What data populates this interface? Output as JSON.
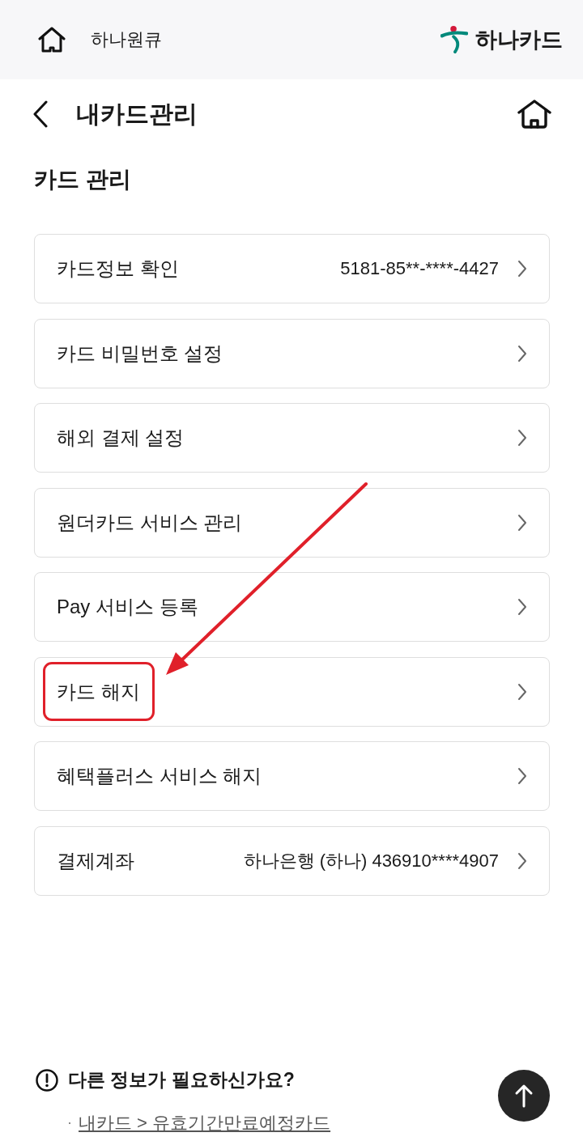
{
  "top_bar": {
    "title": "하나원큐",
    "brand": "하나카드"
  },
  "header": {
    "title": "내카드관리"
  },
  "section": {
    "title": "카드 관리"
  },
  "menu_items": [
    {
      "label": "카드정보 확인",
      "value": "5181-85**-****-4427",
      "highlighted": false
    },
    {
      "label": "카드 비밀번호 설정",
      "highlighted": false
    },
    {
      "label": "해외 결제 설정",
      "highlighted": false
    },
    {
      "label": "원더카드 서비스 관리",
      "highlighted": false
    },
    {
      "label": "Pay 서비스 등록",
      "highlighted": false
    },
    {
      "label": "카드 해지",
      "highlighted": true
    },
    {
      "label": "혜택플러스 서비스 해지",
      "highlighted": false
    },
    {
      "label": "결제계좌",
      "value": "하나은행 (하나) 436910****4907",
      "highlighted": false
    }
  ],
  "help": {
    "title": "다른 정보가 필요하신가요?",
    "links": [
      {
        "bullet": "·",
        "label": "내카드 > 유효기간만료예정카드"
      }
    ]
  }
}
